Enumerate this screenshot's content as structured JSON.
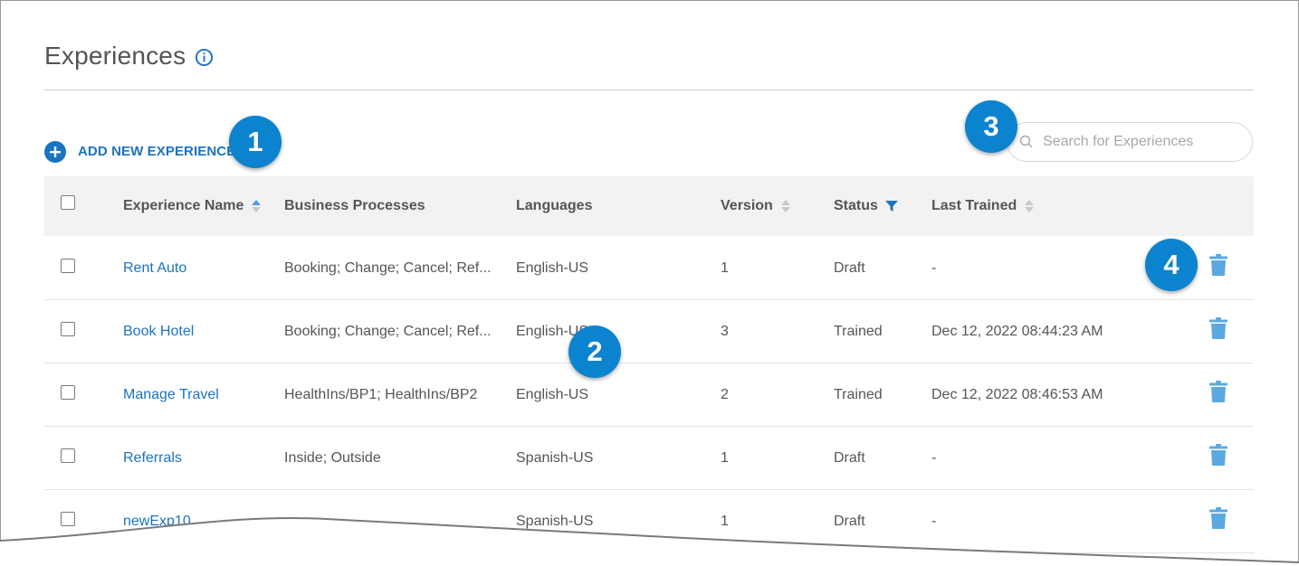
{
  "page": {
    "title": "Experiences",
    "add_button_label": "ADD NEW EXPERIENCE",
    "search_placeholder": "Search for Experiences"
  },
  "callouts": [
    "1",
    "2",
    "3",
    "4"
  ],
  "table": {
    "columns": [
      "Experience Name",
      "Business Processes",
      "Languages",
      "Version",
      "Status",
      "Last Trained"
    ],
    "rows": [
      {
        "name": "Rent Auto",
        "processes": "Booking; Change; Cancel; Ref...",
        "language": "English-US",
        "version": "1",
        "status": "Draft",
        "last_trained": "-"
      },
      {
        "name": "Book Hotel",
        "processes": "Booking; Change; Cancel; Ref...",
        "language": "English-US",
        "version": "3",
        "status": "Trained",
        "last_trained": "Dec 12, 2022 08:44:23 AM"
      },
      {
        "name": "Manage Travel",
        "processes": "HealthIns/BP1; HealthIns/BP2",
        "language": "English-US",
        "version": "2",
        "status": "Trained",
        "last_trained": "Dec 12, 2022 08:46:53 AM"
      },
      {
        "name": "Referrals",
        "processes": "Inside; Outside",
        "language": "Spanish-US",
        "version": "1",
        "status": "Draft",
        "last_trained": "-"
      },
      {
        "name": "newExp10",
        "processes": "",
        "language": "Spanish-US",
        "version": "1",
        "status": "Draft",
        "last_trained": "-"
      }
    ]
  },
  "colors": {
    "accent": "#1a73c1",
    "callout": "#0c83cf",
    "trash": "#5aa9e0",
    "header_bg": "#f2f2f2"
  }
}
